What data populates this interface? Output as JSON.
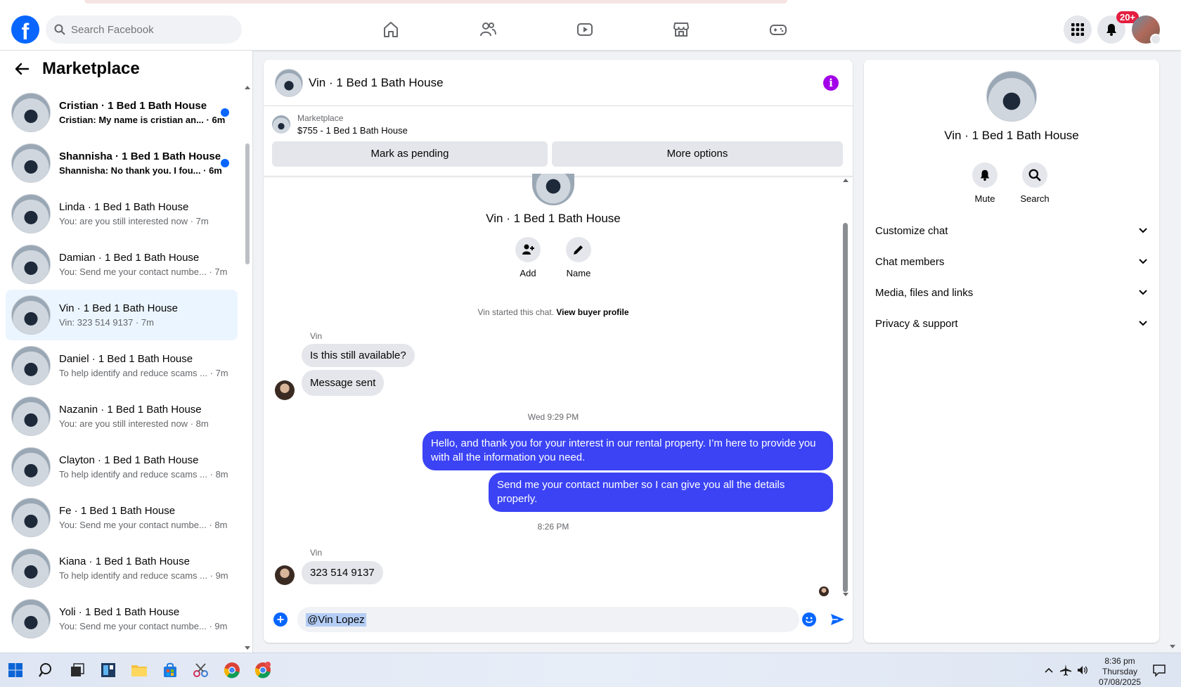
{
  "topbar": {
    "search_placeholder": "Search Facebook",
    "notification_count": "20+",
    "brand_color": "#0866ff"
  },
  "sidebar": {
    "title": "Marketplace",
    "conversations": [
      {
        "name": "Cristian · 1 Bed 1 Bath House",
        "preview": "Cristian: My name is cristian an...",
        "time": " · 6m",
        "unread": true,
        "active": false
      },
      {
        "name": "Shannisha · 1 Bed 1 Bath House",
        "preview": "Shannisha: No thank you. I fou...",
        "time": " · 6m",
        "unread": true,
        "active": false
      },
      {
        "name": "Linda · 1 Bed 1 Bath House",
        "preview": "You: are you still interested now",
        "time": " · 7m",
        "unread": false,
        "active": false
      },
      {
        "name": "Damian · 1 Bed 1 Bath House",
        "preview": "You: Send me your contact numbe...",
        "time": " · 7m",
        "unread": false,
        "active": false
      },
      {
        "name": "Vin · 1 Bed 1 Bath House",
        "preview": "Vin: 323 514 9137",
        "time": " · 7m",
        "unread": false,
        "active": true
      },
      {
        "name": "Daniel · 1 Bed 1 Bath House",
        "preview": "To help identify and reduce scams ...",
        "time": " · 7m",
        "unread": false,
        "active": false
      },
      {
        "name": "Nazanin · 1 Bed 1 Bath House",
        "preview": "You: are you still interested now",
        "time": " · 8m",
        "unread": false,
        "active": false
      },
      {
        "name": "Clayton · 1 Bed 1 Bath House",
        "preview": "To help identify and reduce scams ...",
        "time": " · 8m",
        "unread": false,
        "active": false
      },
      {
        "name": "Fe · 1 Bed 1 Bath House",
        "preview": "You: Send me your contact numbe...",
        "time": " · 8m",
        "unread": false,
        "active": false
      },
      {
        "name": "Kiana · 1 Bed 1 Bath House",
        "preview": "To help identify and reduce scams ...",
        "time": " · 9m",
        "unread": false,
        "active": false
      },
      {
        "name": "Yoli · 1 Bed 1 Bath House",
        "preview": "You: Send me your contact numbe...",
        "time": " · 9m",
        "unread": false,
        "active": false
      }
    ]
  },
  "chat": {
    "title": "Vin · 1 Bed 1 Bath House",
    "listing_label": "Marketplace",
    "listing_price": "$755 - 1 Bed 1 Bath House",
    "mark_pending_label": "Mark as pending",
    "more_options_label": "More options",
    "intro_name": "Vin · 1 Bed 1 Bath House",
    "add_label": "Add",
    "name_label": "Name",
    "started_text": "Vin started this chat. ",
    "view_profile_label": "View buyer profile",
    "sender_name": "Vin",
    "msg1": "Is this still available?",
    "msg2": "Message sent",
    "time1": "Wed 9:29 PM",
    "out1": "Hello, and thank you for your interest in our rental property. I’m here to provide you with all the information you need.",
    "out2": "Send me your contact number so I can give you all the details properly.",
    "time2": "8:26 PM",
    "sender_name2": "Vin",
    "msg3": "323 514 9137",
    "composer_value": "@Vin Lopez"
  },
  "info_panel": {
    "name": "Vin · 1 Bed 1 Bath House",
    "mute_label": "Mute",
    "search_label": "Search",
    "sections": [
      "Customize chat",
      "Chat members",
      "Media, files and links",
      "Privacy & support"
    ]
  },
  "taskbar": {
    "time": "8:36 pm",
    "day": "Thursday",
    "date": "07/08/2025"
  }
}
